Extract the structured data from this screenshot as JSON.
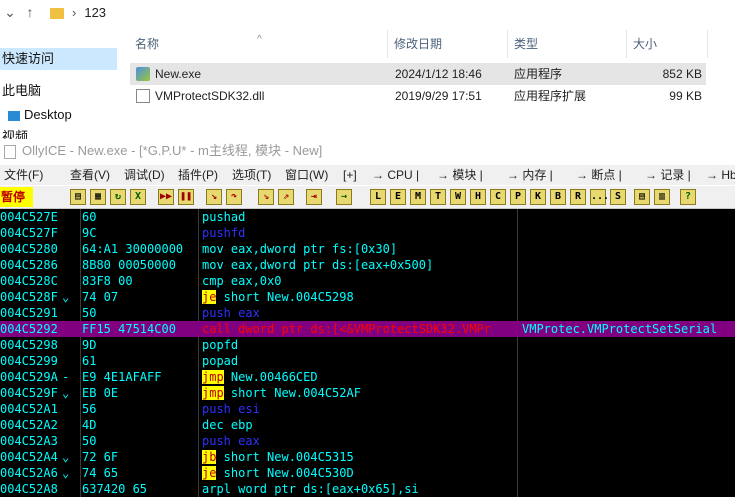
{
  "explorer": {
    "breadcrumb": "123",
    "nav": {
      "quick_access": "快速访问",
      "this_pc": "此电脑",
      "desktop": "Desktop",
      "videos": "视频"
    },
    "columns": {
      "name": "名称",
      "modified": "修改日期",
      "type": "类型",
      "size": "大小"
    },
    "files": [
      {
        "name": "New.exe",
        "modified": "2024/1/12 18:46",
        "type": "应用程序",
        "size": "852 KB",
        "selected": true
      },
      {
        "name": "VMProtectSDK32.dll",
        "modified": "2019/9/29 17:51",
        "type": "应用程序扩展",
        "size": "99 KB",
        "selected": false
      }
    ]
  },
  "olly": {
    "title": "OllyICE - New.exe - [*G.P.U* - m主线程, 模块 - New]",
    "menu": [
      "文件(F)",
      "查看(V)",
      "调试(D)",
      "插件(P)",
      "选项(T)",
      "窗口(W)",
      "[+]",
      "→ CPU |",
      "→ 模块 |",
      "→ 内存 |",
      "→ 断点 |",
      "→ 记录 |",
      "→ Hb"
    ],
    "pause_label": "暂停",
    "toolbar_letters": [
      "L",
      "E",
      "M",
      "T",
      "W",
      "H",
      "C",
      "P",
      "K",
      "B",
      "R",
      "...",
      "S",
      "?"
    ],
    "disasm": [
      {
        "addr": "004C527E",
        "mark": "",
        "hex": "60",
        "ins": "pushad",
        "style": "plain",
        "comment": ""
      },
      {
        "addr": "004C527F",
        "mark": "",
        "hex": "9C",
        "ins": "pushfd",
        "style": "blue",
        "comment": ""
      },
      {
        "addr": "004C5280",
        "mark": "",
        "hex": "64:A1 30000000",
        "ins": "mov eax,dword ptr fs:[0x30]",
        "style": "plain",
        "comment": ""
      },
      {
        "addr": "004C5286",
        "mark": "",
        "hex": "8B80 00050000",
        "ins": "mov eax,dword ptr ds:[eax+0x500]",
        "style": "plain",
        "comment": ""
      },
      {
        "addr": "004C528C",
        "mark": "",
        "hex": "83F8 00",
        "ins": "cmp eax,0x0",
        "style": "plain",
        "comment": ""
      },
      {
        "addr": "004C528F",
        "mark": "⌄",
        "hex": "74 07",
        "kw": "je",
        "ins": " short New.004C5298",
        "style": "jump",
        "comment": ""
      },
      {
        "addr": "004C5291",
        "mark": "",
        "hex": "50",
        "ins": "push eax",
        "style": "blue",
        "comment": ""
      },
      {
        "addr": "004C5292",
        "mark": "",
        "hex": "FF15 47514C00",
        "kw": "call",
        "ins": " dword ptr ds:[<&VMProtectSDK32.VMPr",
        "style": "call",
        "comment": "VMProtec.VMProtectSetSerial",
        "current": true
      },
      {
        "addr": "004C5298",
        "mark": "",
        "hex": "9D",
        "ins": "popfd",
        "style": "plain",
        "comment": ""
      },
      {
        "addr": "004C5299",
        "mark": "",
        "hex": "61",
        "ins": "popad",
        "style": "plain",
        "comment": ""
      },
      {
        "addr": "004C529A",
        "mark": "-",
        "hex": "E9 4E1AFAFF",
        "kw": "jmp",
        "ins": " New.00466CED",
        "style": "jump",
        "comment": ""
      },
      {
        "addr": "004C529F",
        "mark": "⌄",
        "hex": "EB 0E",
        "kw": "jmp",
        "ins": " short New.004C52AF",
        "style": "jump",
        "comment": ""
      },
      {
        "addr": "004C52A1",
        "mark": "",
        "hex": "56",
        "ins": "push esi",
        "style": "blue",
        "comment": ""
      },
      {
        "addr": "004C52A2",
        "mark": "",
        "hex": "4D",
        "ins": "dec ebp",
        "style": "plain",
        "comment": ""
      },
      {
        "addr": "004C52A3",
        "mark": "",
        "hex": "50",
        "ins": "push eax",
        "style": "blue",
        "comment": ""
      },
      {
        "addr": "004C52A4",
        "mark": "⌄",
        "hex": "72 6F",
        "kw": "jb",
        "ins": " short New.004C5315",
        "style": "jump",
        "comment": ""
      },
      {
        "addr": "004C52A6",
        "mark": "⌄",
        "hex": "74 65",
        "kw": "je",
        "ins": " short New.004C530D",
        "style": "jump",
        "comment": ""
      },
      {
        "addr": "004C52A8",
        "mark": "",
        "hex": "637420 65",
        "ins": "arpl word ptr ds:[eax+0x65],si",
        "style": "plain",
        "comment": ""
      }
    ]
  }
}
